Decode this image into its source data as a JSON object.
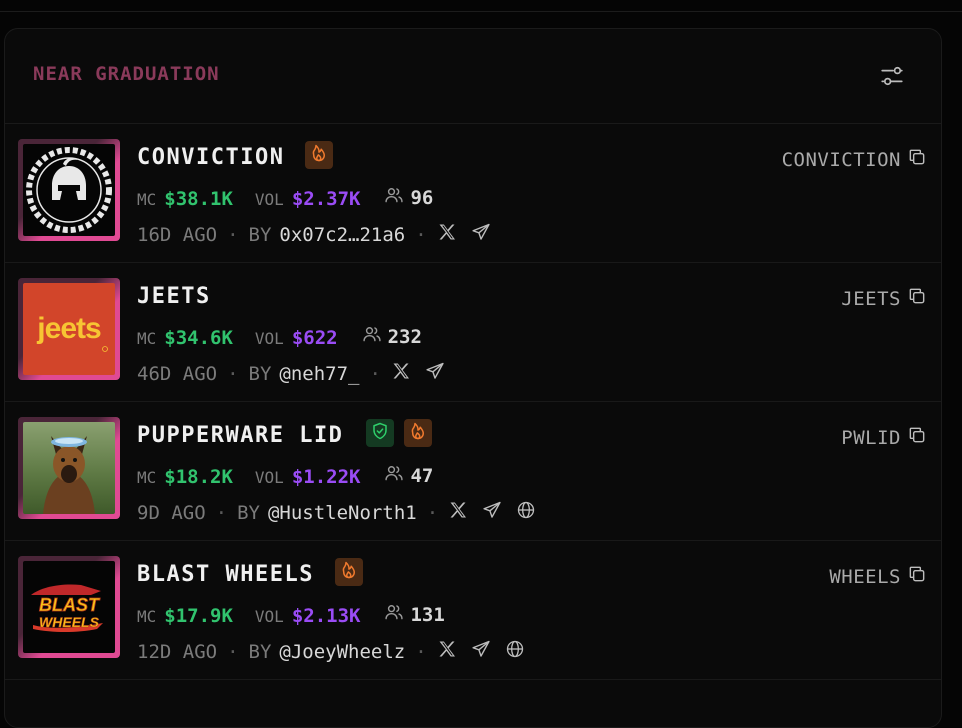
{
  "panel": {
    "title": "NEAR GRADUATION"
  },
  "labels": {
    "mc": "MC",
    "vol": "VOL",
    "by": "BY",
    "dot": "·"
  },
  "colors": {
    "accent_pink": "#e04a93",
    "mc_green": "#31c36e",
    "vol_purple": "#9a4cf5",
    "title_color": "#8a3a5a"
  },
  "tokens": [
    {
      "name": "CONVICTION",
      "ticker": "CONVICTION",
      "mc": "$38.1K",
      "vol": "$2.37K",
      "holders": "96",
      "age": "16D AGO",
      "creator": "0x07c2…21a6",
      "badges": [
        "fire-icon"
      ],
      "socials": [
        "x-icon",
        "telegram-icon"
      ],
      "image": "spartan-helmet-logo"
    },
    {
      "name": "JEETS",
      "ticker": "JEETS",
      "mc": "$34.6K",
      "vol": "$622",
      "holders": "232",
      "age": "46D AGO",
      "creator": "@neh77_",
      "badges": [],
      "socials": [
        "x-icon",
        "telegram-icon"
      ],
      "image": "jeets-logo",
      "image_text": "jeets"
    },
    {
      "name": "PUPPERWARE LID",
      "ticker": "PWLID",
      "mc": "$18.2K",
      "vol": "$1.22K",
      "holders": "47",
      "age": "9D AGO",
      "creator": "@HustleNorth1",
      "badges": [
        "shield-icon",
        "fire-icon"
      ],
      "socials": [
        "x-icon",
        "telegram-icon",
        "globe-icon"
      ],
      "image": "german-shepherd-photo"
    },
    {
      "name": "BLAST WHEELS",
      "ticker": "WHEELS",
      "mc": "$17.9K",
      "vol": "$2.13K",
      "holders": "131",
      "age": "12D AGO",
      "creator": "@JoeyWheelz",
      "badges": [
        "fire-icon"
      ],
      "socials": [
        "x-icon",
        "telegram-icon",
        "globe-icon"
      ],
      "image": "blast-wheels-logo",
      "image_text": [
        "BLAST",
        "WHEELS"
      ]
    }
  ]
}
